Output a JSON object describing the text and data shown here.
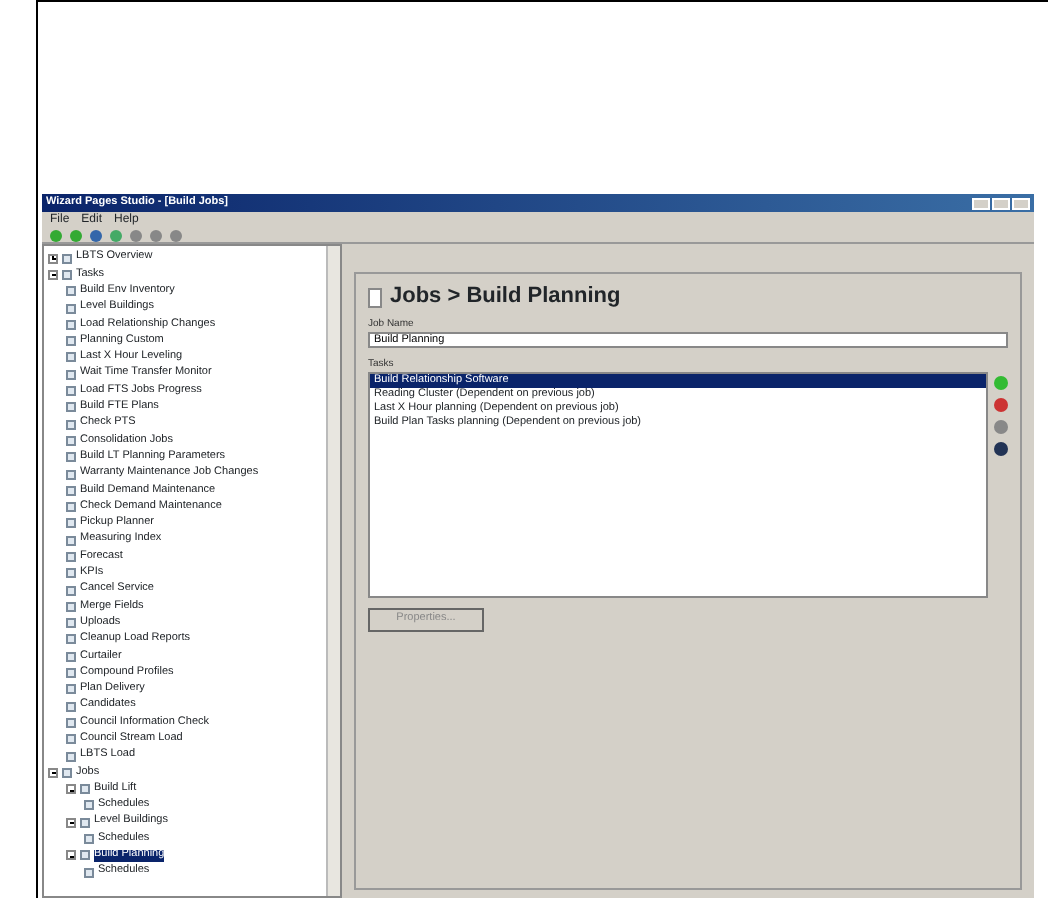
{
  "window": {
    "title": "Wizard Pages Studio - [Build Jobs]"
  },
  "menu": [
    "File",
    "Edit",
    "Help"
  ],
  "tree": [
    {
      "label": "LBTS Overview",
      "expanded": false,
      "selected": false
    },
    {
      "label": "Tasks",
      "expanded": true,
      "selected": false,
      "children": [
        {
          "label": "Build Env Inventory",
          "selected": false
        },
        {
          "label": "Level Buildings",
          "selected": false
        },
        {
          "label": "Load Relationship Changes",
          "selected": false
        },
        {
          "label": "Planning Custom",
          "selected": false
        },
        {
          "label": "Last X Hour Leveling",
          "selected": false
        },
        {
          "label": "Wait Time Transfer Monitor",
          "selected": false
        },
        {
          "label": "Load FTS Jobs Progress",
          "selected": false
        },
        {
          "label": "Build FTE Plans",
          "selected": false
        },
        {
          "label": "Check PTS",
          "selected": false
        },
        {
          "label": "Consolidation Jobs",
          "selected": false
        },
        {
          "label": "Build LT Planning Parameters",
          "selected": false
        },
        {
          "label": "Warranty Maintenance Job Changes",
          "selected": false
        },
        {
          "label": "Build Demand Maintenance",
          "selected": false
        },
        {
          "label": "Check Demand Maintenance",
          "selected": false
        },
        {
          "label": "Pickup Planner",
          "selected": false
        },
        {
          "label": "Measuring Index",
          "selected": false
        },
        {
          "label": "Forecast",
          "selected": false
        },
        {
          "label": "KPIs",
          "selected": false
        },
        {
          "label": "Cancel Service",
          "selected": false
        },
        {
          "label": "Merge Fields",
          "selected": false
        },
        {
          "label": "Uploads",
          "selected": false
        },
        {
          "label": "Cleanup Load Reports",
          "selected": false
        },
        {
          "label": "Curtailer",
          "selected": false
        },
        {
          "label": "Compound Profiles",
          "selected": false
        },
        {
          "label": "Plan Delivery",
          "selected": false
        },
        {
          "label": "Candidates",
          "selected": false
        },
        {
          "label": "Council Information Check",
          "selected": false
        },
        {
          "label": "Council Stream Load",
          "selected": false
        },
        {
          "label": "LBTS Load",
          "selected": false
        }
      ]
    },
    {
      "label": "Jobs",
      "expanded": true,
      "selected": false,
      "children": [
        {
          "label": "Build Lift",
          "expanded": true,
          "selected": false,
          "children": [
            {
              "label": "Schedules",
              "selected": false
            }
          ]
        },
        {
          "label": "Level Buildings",
          "expanded": true,
          "selected": false,
          "children": [
            {
              "label": "Schedules",
              "selected": false
            }
          ]
        },
        {
          "label": "Build Planning",
          "expanded": true,
          "selected": true,
          "children": [
            {
              "label": "Schedules",
              "selected": false
            }
          ]
        }
      ]
    }
  ],
  "panel": {
    "heading": "Jobs > Build Planning",
    "name_label": "Job Name",
    "name_value": "Build Planning",
    "tasks_label": "Tasks",
    "tasks": [
      {
        "label": "Build Relationship Software",
        "selected": true
      },
      {
        "label": "Reading Cluster (Dependent on previous job)",
        "selected": false
      },
      {
        "label": "Last X Hour planning (Dependent on previous job)",
        "selected": false
      },
      {
        "label": "Build Plan Tasks planning (Dependent on previous job)",
        "selected": false
      }
    ],
    "button": "Properties..."
  }
}
